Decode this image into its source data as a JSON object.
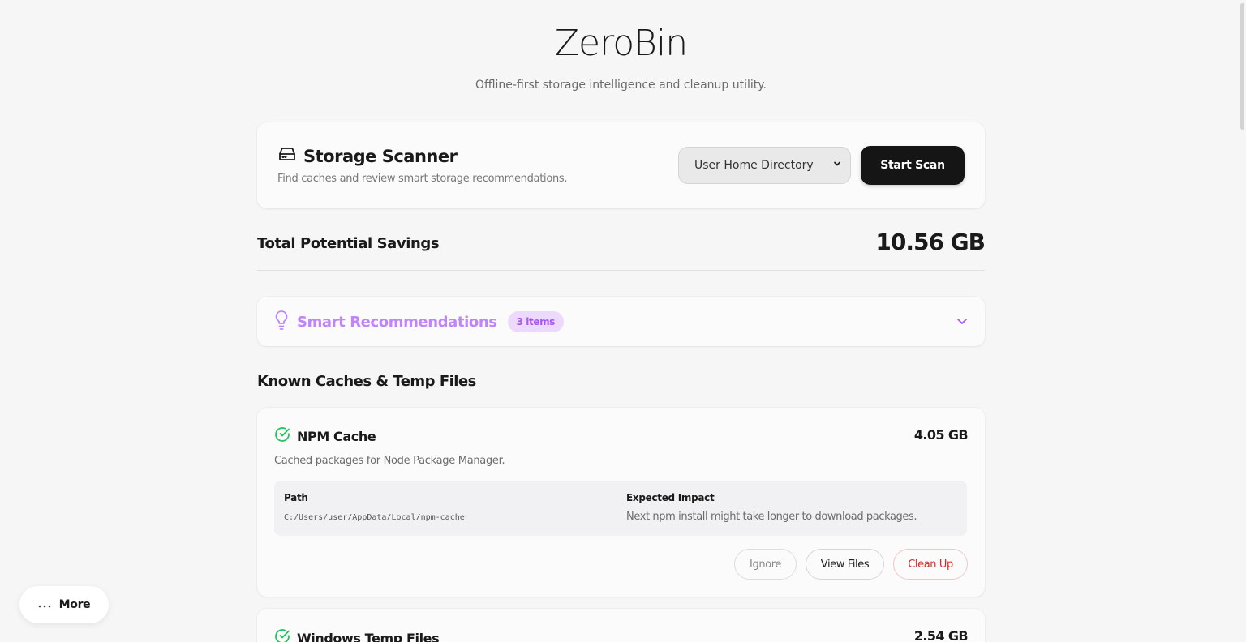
{
  "header": {
    "title": "ZeroBin",
    "subtitle": "Offline-first storage intelligence and cleanup utility."
  },
  "scanner": {
    "title": "Storage Scanner",
    "description": "Find caches and review smart storage recommendations.",
    "directory_selected": "User Home Directory",
    "start_label": "Start Scan",
    "icon": "hard-drive-icon"
  },
  "savings": {
    "label": "Total Potential Savings",
    "value": "10.56 GB"
  },
  "recommendations": {
    "title": "Smart Recommendations",
    "badge": "3 items",
    "icon": "lightbulb-icon",
    "accent": "#c084fc"
  },
  "caches_heading": "Known Caches & Temp Files",
  "caches": [
    {
      "name": "NPM Cache",
      "size": "4.05 GB",
      "description": "Cached packages for Node Package Manager.",
      "path_label": "Path",
      "path": "C:/Users/user/AppData/Local/npm-cache",
      "impact_label": "Expected Impact",
      "impact": "Next npm install might take longer to download packages.",
      "actions": {
        "ignore": "Ignore",
        "view": "View Files",
        "clean": "Clean Up"
      },
      "status_color": "#22c55e"
    },
    {
      "name": "Windows Temp Files",
      "size": "2.54 GB",
      "status_color": "#22c55e"
    }
  ],
  "more_label": "More"
}
